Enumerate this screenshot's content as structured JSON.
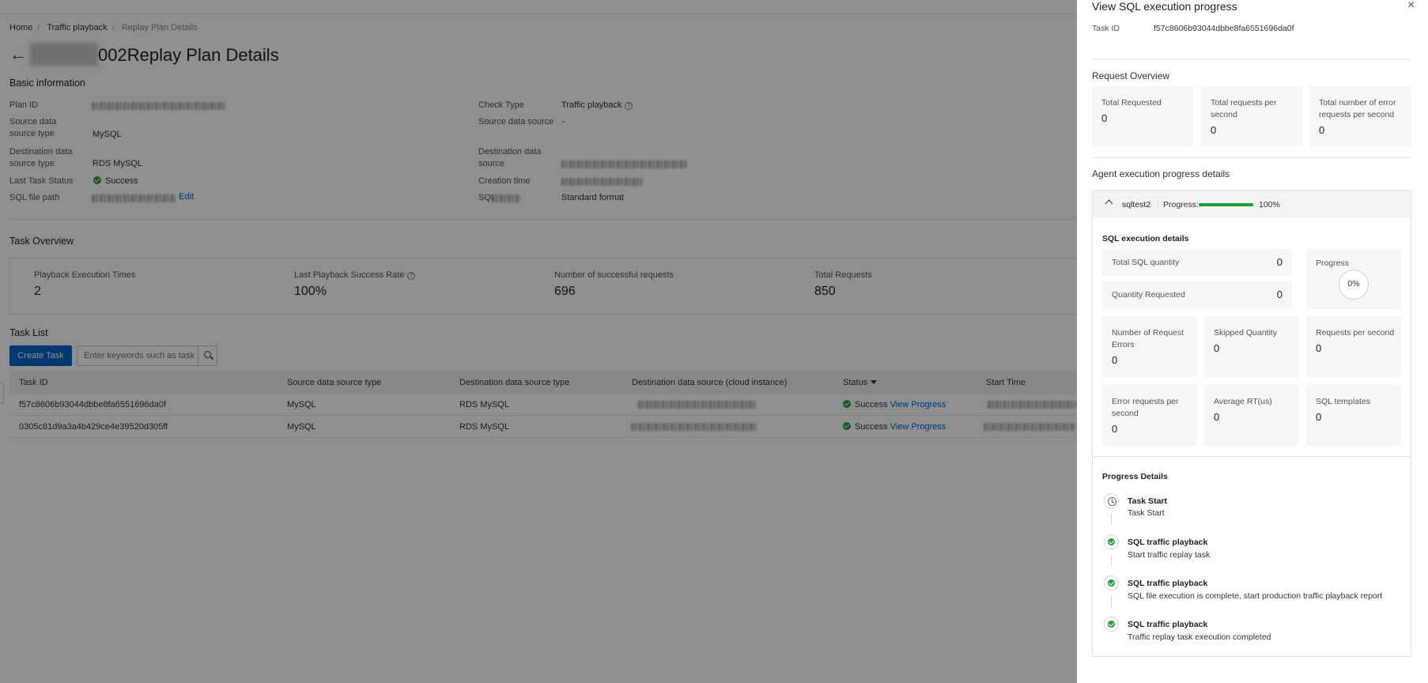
{
  "breadcrumb": {
    "home": "Home",
    "traffic": "Traffic playback",
    "current": "Replay Plan Details"
  },
  "page": {
    "title_suffix": "002Replay Plan Details"
  },
  "basic": {
    "section": "Basic information",
    "plan_id_label": "Plan ID",
    "source_type_label": "Source data source type",
    "source_type_value": "MySQL",
    "dest_type_label": "Destination data source type",
    "dest_type_value": "RDS MySQL",
    "last_status_label": "Last Task Status",
    "last_status_value": "Success",
    "sql_path_label": "SQL file path",
    "edit_link": "Edit",
    "check_type_label": "Check Type",
    "check_type_value": "Traffic playback",
    "source_ds_label": "Source data source",
    "source_ds_value": "-",
    "dest_ds_label": "Destination data source",
    "creation_label": "Creation time",
    "sql_format_label": "SQL",
    "sql_format_value": "Standard format"
  },
  "overview": {
    "section": "Task Overview",
    "items": [
      {
        "label": "Playback Execution Times",
        "value": "2"
      },
      {
        "label": "Last Playback Success Rate",
        "value": "100%"
      },
      {
        "label": "Number of successful requests",
        "value": "696"
      },
      {
        "label": "Total Requests",
        "value": "850"
      }
    ]
  },
  "tasks": {
    "section": "Task List",
    "create_button": "Create Task",
    "search_placeholder": "Enter keywords such as task ID",
    "columns": [
      "Task ID",
      "Source data source type",
      "Destination data source type",
      "Destination data source (cloud instance)",
      "Status",
      "Start Time"
    ],
    "rows": [
      {
        "task_id": "f57c8606b93044dbbe8fa6551696da0f",
        "source": "MySQL",
        "dest": "RDS MySQL",
        "status": "Success",
        "action": "View Progress"
      },
      {
        "task_id": "0305c81d9a3a4b429ce4e39520d305ff",
        "source": "MySQL",
        "dest": "RDS MySQL",
        "status": "Success",
        "action": "View Progress"
      }
    ]
  },
  "drawer": {
    "title": "View SQL execution progress",
    "close": "×",
    "task_id_label": "Task ID",
    "task_id_value": "f57c8606b93044dbbe8fa6551696da0f",
    "request_overview": "Request Overview",
    "req_cards": [
      {
        "label": "Total Requested",
        "value": "0"
      },
      {
        "label": "Total requests per second",
        "value": "0"
      },
      {
        "label": "Total number of error requests per second",
        "value": "0"
      }
    ],
    "agent_section": "Agent execution progress details",
    "agent": {
      "name": "sqltest2",
      "progress_label": "Progress:",
      "progress_value": 1.0,
      "progress_text": "100%"
    },
    "sql_details_title": "SQL execution details",
    "total_sql": {
      "label": "Total SQL quantity",
      "value": "0"
    },
    "qty_requested": {
      "label": "Quantity Requested",
      "value": "0"
    },
    "progress": {
      "label": "Progress",
      "value": "0%"
    },
    "metrics": [
      {
        "label": "Number of Request Errors",
        "value": "0"
      },
      {
        "label": "Skipped Quantity",
        "value": "0"
      },
      {
        "label": "Requests per second",
        "value": "0"
      },
      {
        "label": "Error requests per second",
        "value": "0"
      },
      {
        "label": "Average RT(us)",
        "value": "0"
      },
      {
        "label": "SQL templates",
        "value": "0"
      }
    ],
    "progress_details_title": "Progress Details",
    "timeline": [
      {
        "title": "Task Start",
        "desc": "Task Start",
        "icon": "clock-icon"
      },
      {
        "title": "SQL traffic playback",
        "desc": "Start traffic replay task",
        "icon": "check-circle-icon"
      },
      {
        "title": "SQL traffic playback",
        "desc": "SQL file execution is complete, start production traffic playback report",
        "icon": "check-circle-icon"
      },
      {
        "title": "SQL traffic playback",
        "desc": "Traffic replay task execution completed",
        "icon": "check-circle-icon"
      }
    ]
  }
}
